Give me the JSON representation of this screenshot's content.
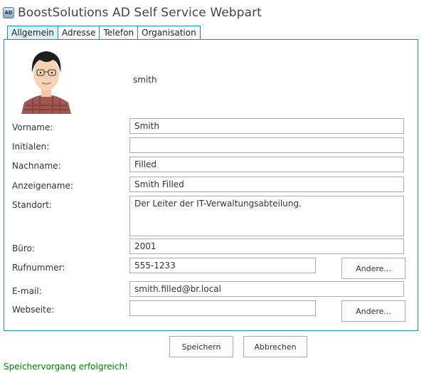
{
  "header": {
    "app_icon_text": "AD",
    "title": "BoostSolutions AD Self Service Webpart"
  },
  "tabs": [
    {
      "label": "Allgemein",
      "active": true
    },
    {
      "label": "Adresse",
      "active": false
    },
    {
      "label": "Telefon",
      "active": false
    },
    {
      "label": "Organisation",
      "active": false
    }
  ],
  "profile": {
    "username": "smith"
  },
  "form": {
    "vorname": {
      "label": "Vorname:",
      "value": "Smith"
    },
    "initialen": {
      "label": "Initialen:",
      "value": ""
    },
    "nachname": {
      "label": "Nachname:",
      "value": "Filled"
    },
    "anzeigename": {
      "label": "Anzeigename:",
      "value": "Smith Filled"
    },
    "standort": {
      "label": "Standort:",
      "value": "Der Leiter der IT-Verwaltungsabteilung."
    },
    "buero": {
      "label": "Büro:",
      "value": "2001"
    },
    "rufnummer": {
      "label": "Rufnummer:",
      "value": "555-1233",
      "button": "Andere..."
    },
    "email": {
      "label": "E-mail:",
      "value": "smith.filled@br.local"
    },
    "webseite": {
      "label": "Webseite:",
      "value": "",
      "button": "Andere..."
    }
  },
  "actions": {
    "save": "Speichern",
    "cancel": "Abbrechen"
  },
  "status": {
    "message": "Speichervorgang erfolgreich!"
  },
  "colors": {
    "accent": "#1e8ab0",
    "active_tab": "#dff1f7",
    "success": "#008000"
  }
}
